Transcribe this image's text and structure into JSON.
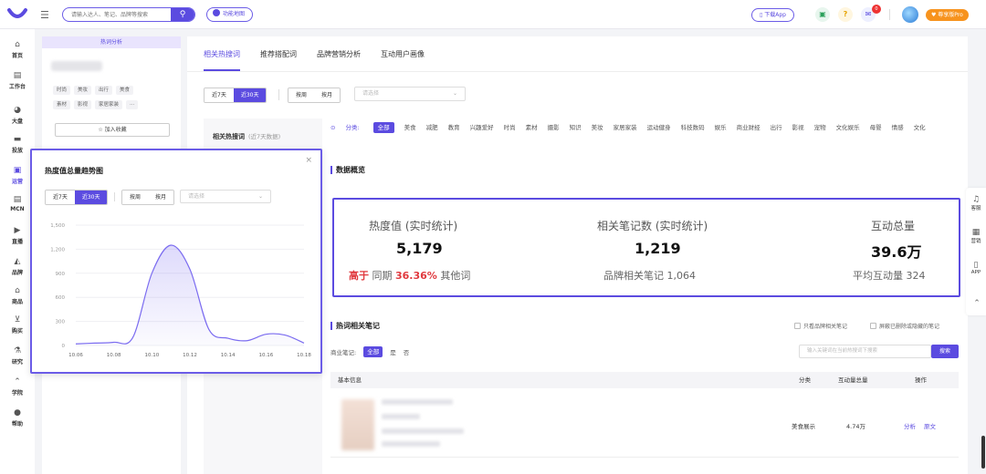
{
  "colors": {
    "accent": "#5b4be0",
    "positive": "#e0393e",
    "vip": "#f7931e"
  },
  "topbar": {
    "search_placeholder": "请输入达人、笔记、品牌等搜索",
    "function_map": "功能地图",
    "download_app": "下载App",
    "badge_count": "0",
    "vip_label": "尊享版Pro"
  },
  "sidebar": {
    "items": [
      {
        "label": "首页",
        "icon": "home-icon"
      },
      {
        "label": "工作台",
        "icon": "desk-icon"
      },
      {
        "label": "大盘",
        "icon": "pie-icon"
      },
      {
        "label": "投放",
        "icon": "folder-icon"
      },
      {
        "label": "运营",
        "icon": "chat-icon"
      },
      {
        "label": "MCN",
        "icon": "doc-icon"
      },
      {
        "label": "直播",
        "icon": "video-icon"
      },
      {
        "label": "品牌",
        "icon": "brand-icon"
      },
      {
        "label": "商品",
        "icon": "shop-icon"
      },
      {
        "label": "购买",
        "icon": "cart-icon"
      },
      {
        "label": "研究",
        "icon": "flask-icon"
      },
      {
        "label": "学院",
        "icon": "cap-icon"
      },
      {
        "label": "帮助",
        "icon": "help-icon"
      }
    ]
  },
  "left_panel": {
    "header": "热词分析",
    "tags_row1": [
      "时尚",
      "美妆",
      "出行",
      "美食"
    ],
    "tags_row2": [
      "素材",
      "影视",
      "家居家装",
      "···"
    ],
    "collect": "加入收藏"
  },
  "main": {
    "tabs": [
      "相关热搜词",
      "推荐搭配词",
      "品牌营销分析",
      "互动用户画像"
    ],
    "range_options": [
      "近7天",
      "近30天"
    ],
    "period_options": [
      "按周",
      "按月"
    ],
    "select_placeholder": "请选择",
    "inner_left_title": "相关热搜词",
    "inner_left_sub": "(近7天数据)",
    "category_label": "分类:",
    "categories": [
      "全部",
      "美食",
      "减肥",
      "教育",
      "兴趣爱好",
      "时尚",
      "素材",
      "摄影",
      "知识",
      "美妆",
      "家居家装",
      "运动健身",
      "科技数码",
      "娱乐",
      "商业财经",
      "出行",
      "影视",
      "宠物",
      "文化娱乐",
      "母婴",
      "情感",
      "文化"
    ],
    "overview_title": "数据概览",
    "stats": [
      {
        "title": "热度值 (实时统计)",
        "value": "5,179",
        "sub_prefix": "高于",
        "sub_mid": "同期",
        "sub_pct": "36.36%",
        "sub_suffix": "其他词"
      },
      {
        "title": "相关笔记数 (实时统计)",
        "value": "1,219",
        "sub": "品牌相关笔记 1,064"
      },
      {
        "title": "互动总量",
        "value": "39.6万",
        "sub": "平均互动量 324"
      }
    ],
    "notes_title": "热词相关笔记",
    "check_brand": "只看品牌相关笔记",
    "check_hide": "屏蔽已删除或隐藏的笔记",
    "biz_label": "商业笔记:",
    "biz_options": [
      "全部",
      "是",
      "否"
    ],
    "keyword_placeholder": "输入关键词在当前热搜词下搜索",
    "keyword_btn": "搜索",
    "table_headers": [
      "基本信息",
      "分类",
      "互动量总量",
      "操作"
    ],
    "row": {
      "category": "美食展示",
      "interactions": "4.74万",
      "action1": "分析",
      "action2": "原文"
    }
  },
  "right_tools": [
    {
      "label": "客服",
      "icon": "headset-icon"
    },
    {
      "label": "营销",
      "icon": "marketing-icon"
    },
    {
      "label": "APP",
      "icon": "phone-icon"
    }
  ],
  "popup": {
    "title": "热度值总量趋势图",
    "range_options": [
      "近7天",
      "近30天"
    ],
    "period_options": [
      "按周",
      "按月"
    ],
    "select_placeholder": "请选择"
  },
  "chart_data": {
    "type": "area",
    "x": [
      "10.06",
      "10.07",
      "10.08",
      "10.09",
      "10.10",
      "10.11",
      "10.12",
      "10.13",
      "10.14",
      "10.15",
      "10.16",
      "10.17",
      "10.18"
    ],
    "values": [
      20,
      30,
      40,
      100,
      900,
      1250,
      950,
      200,
      90,
      60,
      140,
      130,
      30
    ],
    "ylim": [
      0,
      1500
    ],
    "yticks": [
      0,
      300,
      600,
      900,
      1200,
      1500
    ],
    "yticklabels": [
      "0",
      "300",
      "600",
      "900",
      "1,200",
      "1,500"
    ],
    "xticklabels": [
      "10.06",
      "10.08",
      "10.10",
      "10.12",
      "10.14",
      "10.16",
      "10.18"
    ],
    "xtick_values": [
      "10.06",
      "10.08",
      "10.10",
      "10.12",
      "10.14",
      "10.16",
      "10.18"
    ],
    "grid": true,
    "line_color": "#7b6cf0"
  }
}
